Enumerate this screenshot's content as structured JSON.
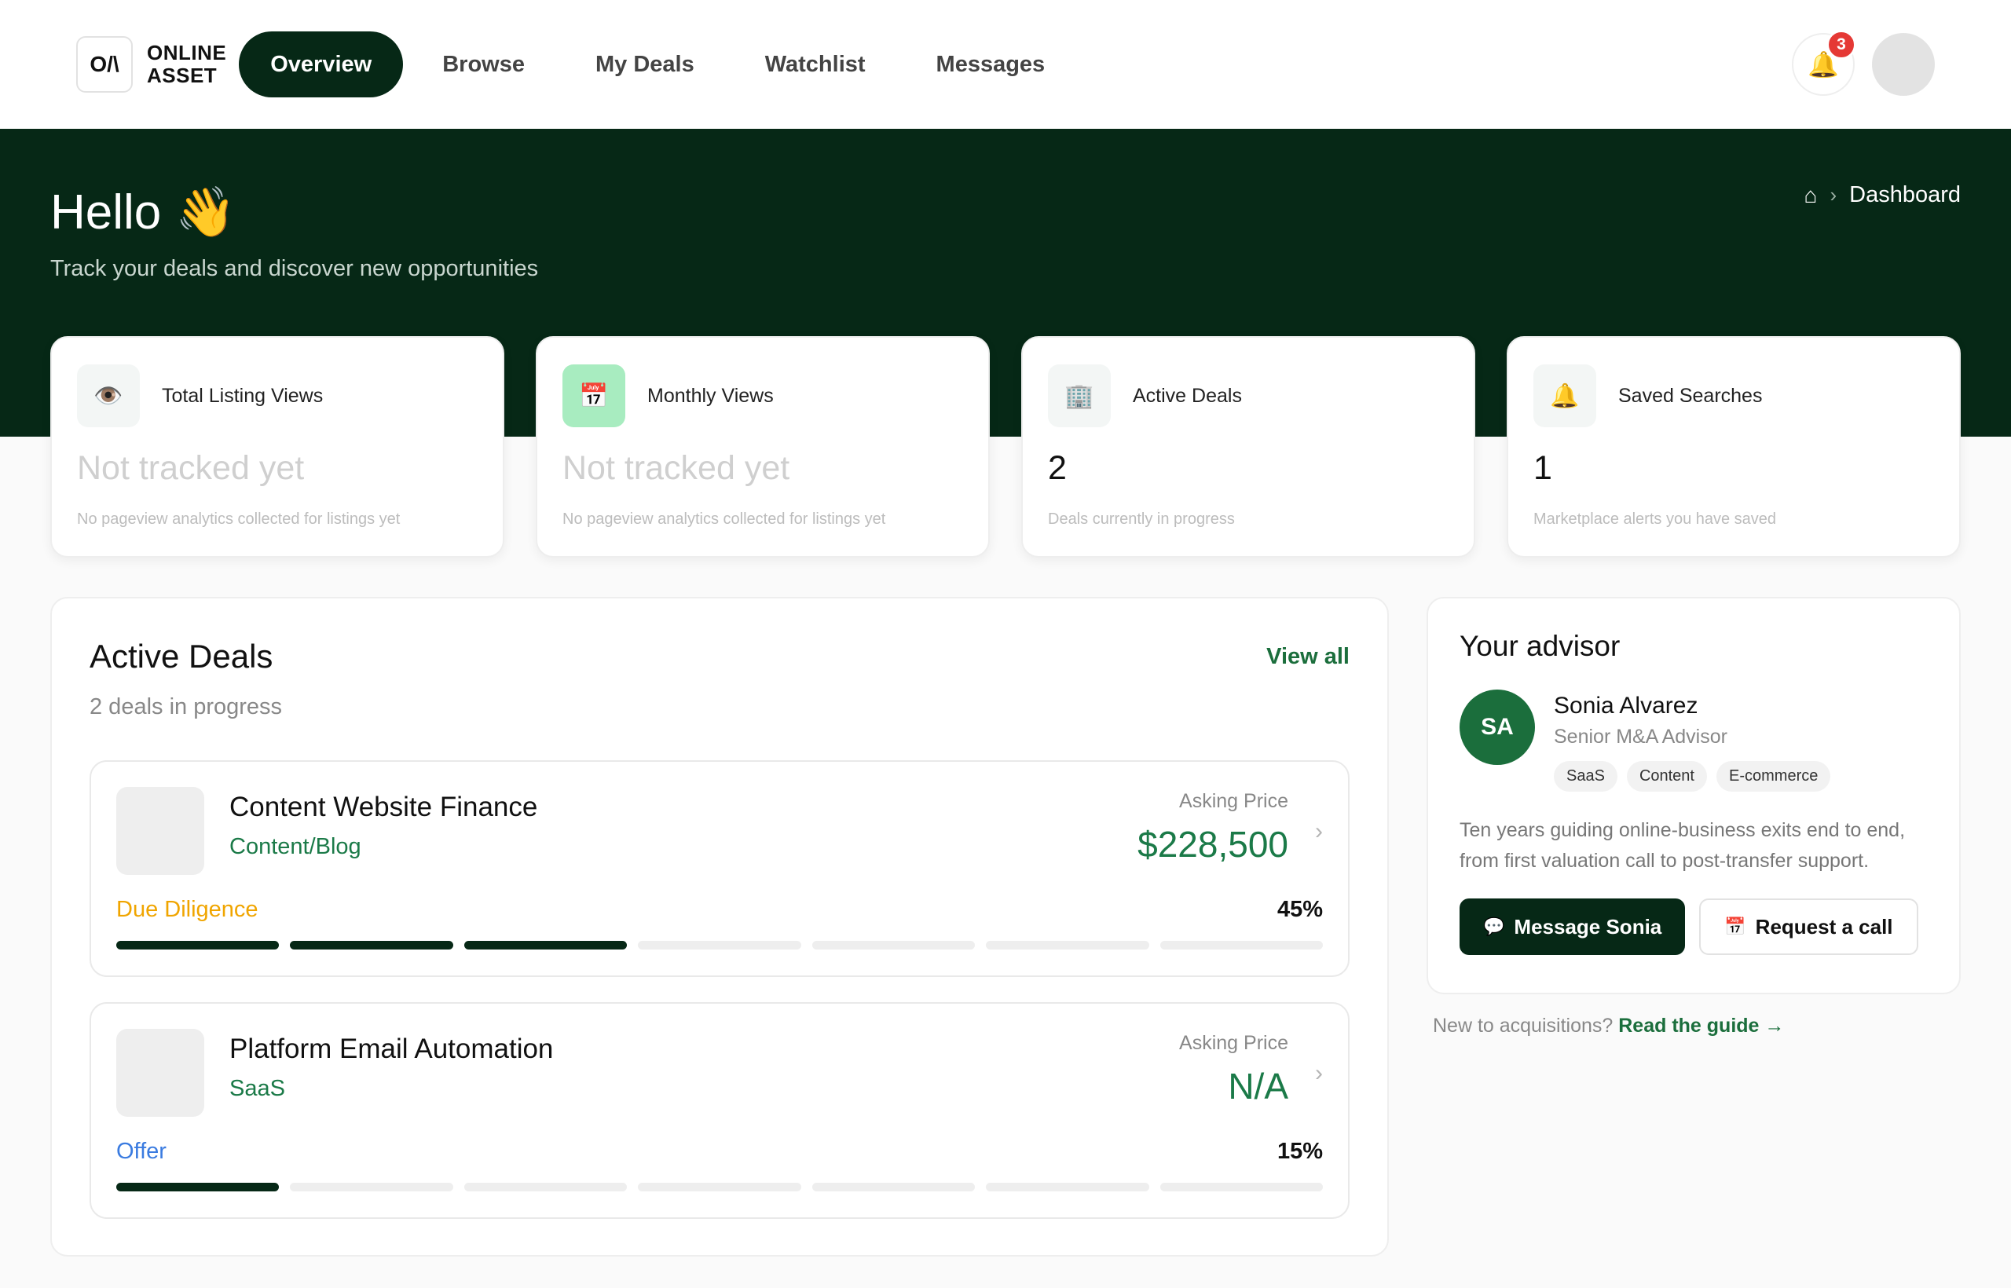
{
  "brand": {
    "mark": "O/\\",
    "line1": "ONLINE",
    "line2": "ASSET"
  },
  "nav": {
    "items": [
      {
        "label": "Overview",
        "active": true
      },
      {
        "label": "Browse"
      },
      {
        "label": "My Deals"
      },
      {
        "label": "Watchlist"
      },
      {
        "label": "Messages"
      }
    ],
    "notifications": "3",
    "bell_icon": "🔔"
  },
  "hero": {
    "greeting": "Hello",
    "wave": "👋",
    "subtitle": "Track your deals and discover new opportunities",
    "breadcrumb": {
      "home_icon": "⌂",
      "separator": "›",
      "current": "Dashboard"
    }
  },
  "stats": [
    {
      "icon": "👁️",
      "title": "Total Listing Views",
      "value": "Not tracked yet",
      "desc": "No pageview analytics collected for listings yet"
    },
    {
      "icon": "📅",
      "title": "Monthly Views",
      "value": "Not tracked yet",
      "desc": "No pageview analytics collected for listings yet"
    },
    {
      "icon": "🏢",
      "title": "Active Deals",
      "value": "2",
      "desc": "Deals currently in progress"
    },
    {
      "icon": "🔔",
      "title": "Saved Searches",
      "value": "1",
      "desc": "Marketplace alerts you have saved"
    }
  ],
  "deals": {
    "title": "Active Deals",
    "view_all": "View all",
    "subtitle": "2 deals in progress",
    "items": [
      {
        "name": "Content Website Finance",
        "category": "Content/Blog",
        "price_label": "Asking Price",
        "price": "$228,500",
        "stage": "Due Diligence",
        "percent": "45%",
        "progress": 0.45
      },
      {
        "name": "Platform Email Automation",
        "category": "SaaS",
        "price_label": "Asking Price",
        "price": "N/A",
        "stage": "Offer",
        "percent": "15%",
        "progress": 0.15
      }
    ],
    "chevron": "›"
  },
  "advisor": {
    "title": "Your advisor",
    "initials": "SA",
    "name": "Sonia Alvarez",
    "role": "Senior M&A Advisor",
    "tags": [
      "SaaS",
      "Content",
      "E-commerce"
    ],
    "bio": "Ten years guiding online-business exits end to end, from first valuation call to post-transfer support.",
    "message_icon": "💬",
    "message_label": "Message Sonia",
    "call_icon": "📅",
    "call_label": "Request a call"
  },
  "guide": {
    "prefix": "New to acquisitions?",
    "link": "Read the guide →"
  }
}
